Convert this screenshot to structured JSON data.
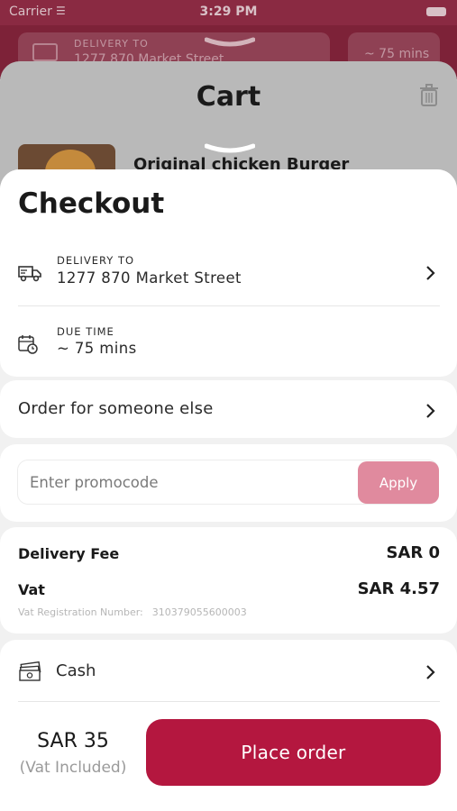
{
  "status_bar": {
    "carrier": "Carrier",
    "time": "3:29 PM"
  },
  "background": {
    "delivery_chip": {
      "label": "DELIVERY TO",
      "value": "1277 870 Market Street"
    },
    "time_chip": {
      "value": "~ 75 mins"
    },
    "cart": {
      "title": "Cart",
      "item_name": "Original chicken Burger"
    }
  },
  "checkout": {
    "title": "Checkout",
    "delivery": {
      "label": "DELIVERY TO",
      "value": "1277 870 Market Street"
    },
    "due_time": {
      "label": "DUE TIME",
      "value": "~ 75 mins"
    },
    "order_for_someone": "Order for someone else",
    "promo": {
      "placeholder": "Enter promocode",
      "value": "",
      "apply_label": "Apply"
    },
    "fees": {
      "delivery_fee_label": "Delivery Fee",
      "delivery_fee_value": "SAR 0",
      "vat_label": "Vat",
      "vat_value": "SAR 4.57",
      "vat_reg_label": "Vat Registration Number:",
      "vat_reg_number": "310379055600003"
    },
    "payment": {
      "method": "Cash"
    },
    "total": {
      "amount": "SAR 35",
      "note": "(Vat Included)"
    },
    "place_order_label": "Place order"
  },
  "colors": {
    "accent": "#b4173f",
    "apply_button": "#e08a9e",
    "header_bg": "#7d2238"
  }
}
